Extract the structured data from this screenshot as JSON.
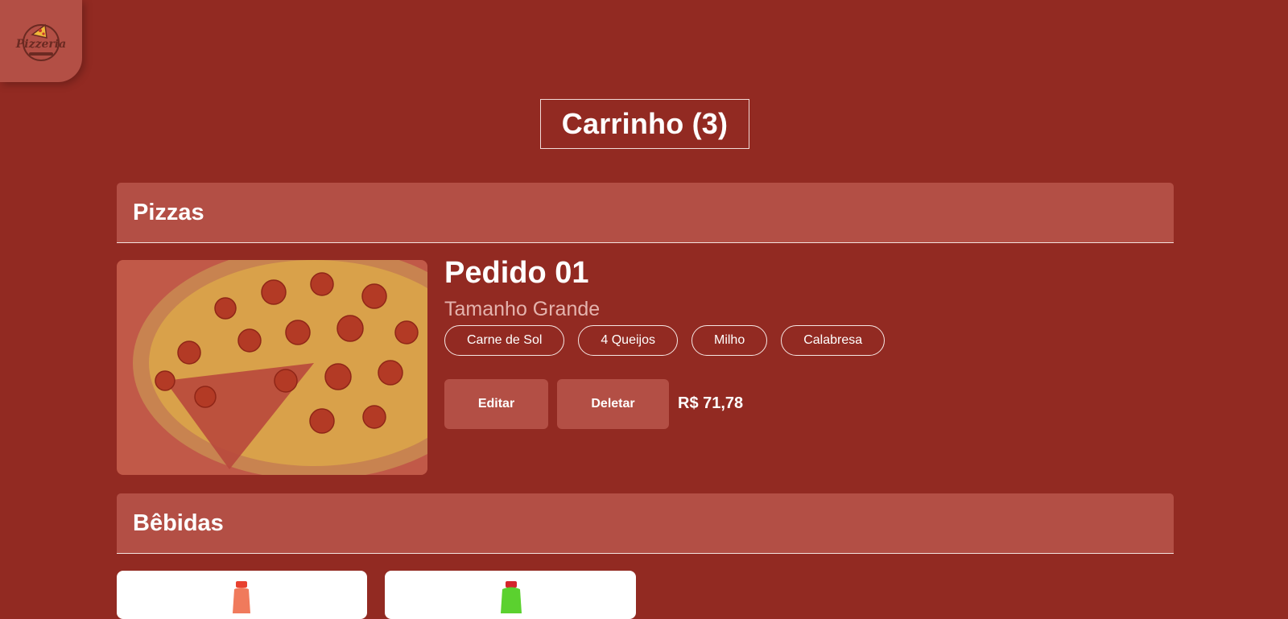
{
  "logo": {
    "text": "Pizzeria"
  },
  "cart": {
    "title": "Carrinho (3)"
  },
  "sections": {
    "pizzas": "Pizzas",
    "bebidas": "Bêbidas"
  },
  "order": {
    "title": "Pedido 01",
    "size": "Tamanho Grande",
    "flavors": [
      "Carne de Sol",
      "4 Queijos",
      "Milho",
      "Calabresa"
    ],
    "edit_label": "Editar",
    "delete_label": "Deletar",
    "price": "R$ 71,78"
  },
  "colors": {
    "background": "#922a22",
    "panel": "#b34f45",
    "text": "#ffffff",
    "muted_text": "#e4b3ad"
  },
  "drinks": [
    {
      "icon": "soda-bottle-red-icon"
    },
    {
      "icon": "soda-bottle-green-icon"
    }
  ]
}
